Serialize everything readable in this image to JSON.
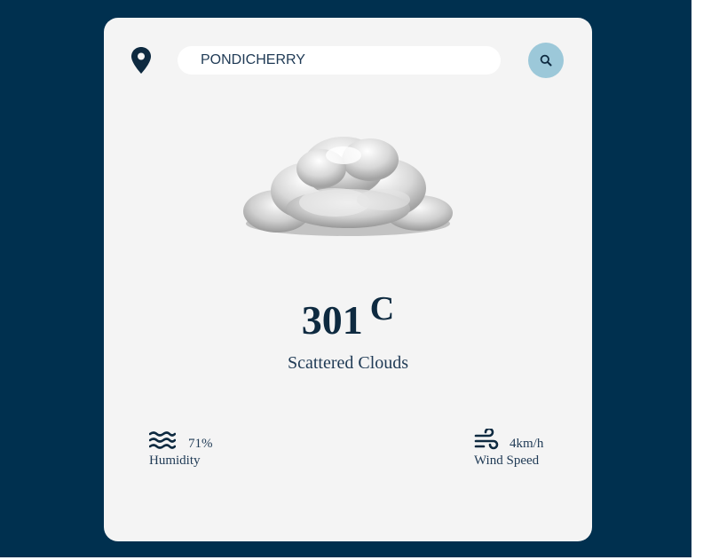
{
  "search": {
    "value": "PONDICHERRY"
  },
  "weather": {
    "temperature": "301",
    "unit": "C",
    "condition": "Scattered Clouds",
    "icon": "cloud-icon"
  },
  "stats": {
    "humidity": {
      "value": "71%",
      "label": "Humidity",
      "icon": "waves-icon"
    },
    "wind": {
      "value": "4km/h",
      "label": "Wind Speed",
      "icon": "wind-icon"
    }
  },
  "colors": {
    "background": "#00304f",
    "card": "#f4f4f4",
    "accent": "#9cc8d9",
    "text": "#0e2a40"
  }
}
